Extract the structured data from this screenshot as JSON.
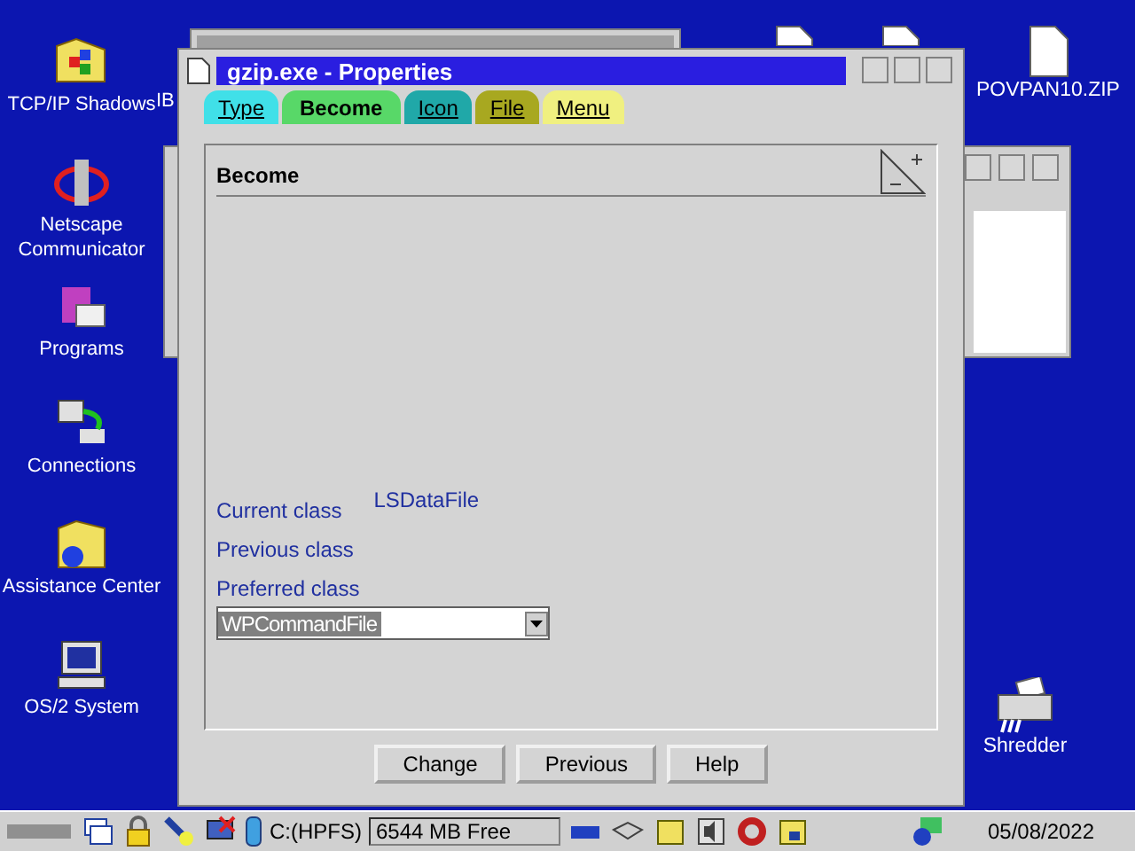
{
  "desktop_icons": [
    {
      "label": "TCP/IP Shadows"
    },
    {
      "label": "Netscape\nCommunicator"
    },
    {
      "label": "Programs"
    },
    {
      "label": "Connections"
    },
    {
      "label": "Assistance Center"
    },
    {
      "label": "OS/2 System"
    }
  ],
  "partial_label": "IB",
  "top_file_label": "POVPAN10.ZIP",
  "shredder_label": "Shredder",
  "window": {
    "title": "gzip.exe - Properties",
    "tabs": [
      {
        "label": "Type",
        "selected": false,
        "color": "#40e0e8"
      },
      {
        "label": "Become",
        "selected": true,
        "color": "#58d868"
      },
      {
        "label": "Icon",
        "selected": false,
        "color": "#20a8a8"
      },
      {
        "label": "File",
        "selected": false,
        "color": "#a8a820"
      },
      {
        "label": "Menu",
        "selected": false,
        "color": "#f0f080"
      }
    ],
    "page": {
      "heading": "Become",
      "current_class": {
        "label": "Current class",
        "value": "LSDataFile"
      },
      "previous_class": {
        "label": "Previous class"
      },
      "preferred_class": {
        "label": "Preferred class",
        "value": "WPCommandFile"
      }
    },
    "buttons": [
      "Change",
      "Previous",
      "Help"
    ]
  },
  "taskbar": {
    "drive": "C:(HPFS)",
    "free": "6544 MB Free",
    "date": "05/08/2022"
  }
}
